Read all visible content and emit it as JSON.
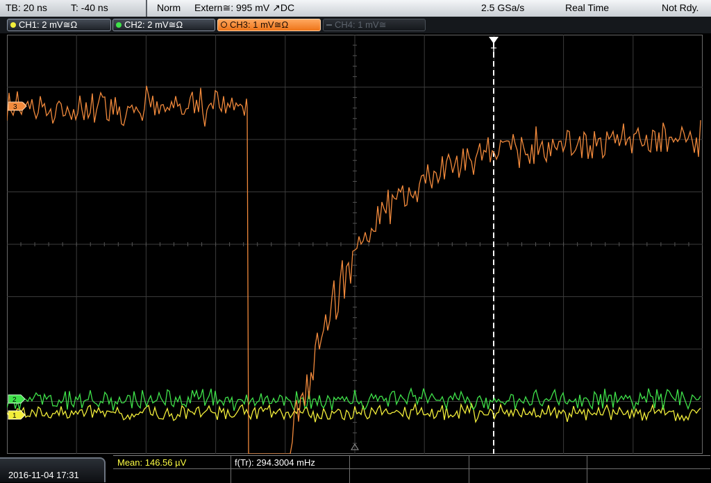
{
  "topbar": {
    "timebase": "TB: 20 ns",
    "trigger_time": "T: -40 ns",
    "trigger_mode": "Norm",
    "trigger_source": "Extern≅: 995 mV ↗DC",
    "sample_rate": "2.5 GSa/s",
    "acq_mode": "Real Time",
    "status": "Not Rdy."
  },
  "channels": [
    {
      "label": "CH1: 2 mV≅Ω",
      "color": "#f2ee3a",
      "state": "on"
    },
    {
      "label": "CH2: 2 mV≅Ω",
      "color": "#3fe24a",
      "state": "on"
    },
    {
      "label": "CH3: 1 mV≅Ω",
      "color": "#f28a3c",
      "state": "active"
    },
    {
      "label": "CH4: 1 mV≅",
      "color": "#6a7078",
      "state": "off"
    }
  ],
  "markers": {
    "trigger": "T",
    "ch1": "1",
    "ch2": "2",
    "ch3": "3"
  },
  "bottom": {
    "datetime": "2016-11-04 17:31",
    "mean": "Mean: 146.56 µV",
    "freq": "f(Tr): 294.3004 mHz"
  },
  "colors": {
    "grid": "#3b3b3b",
    "ch1": "#f2ee3a",
    "ch2": "#3fe24a",
    "ch3": "#f28a3c",
    "meas_label": "#ffff44"
  }
}
